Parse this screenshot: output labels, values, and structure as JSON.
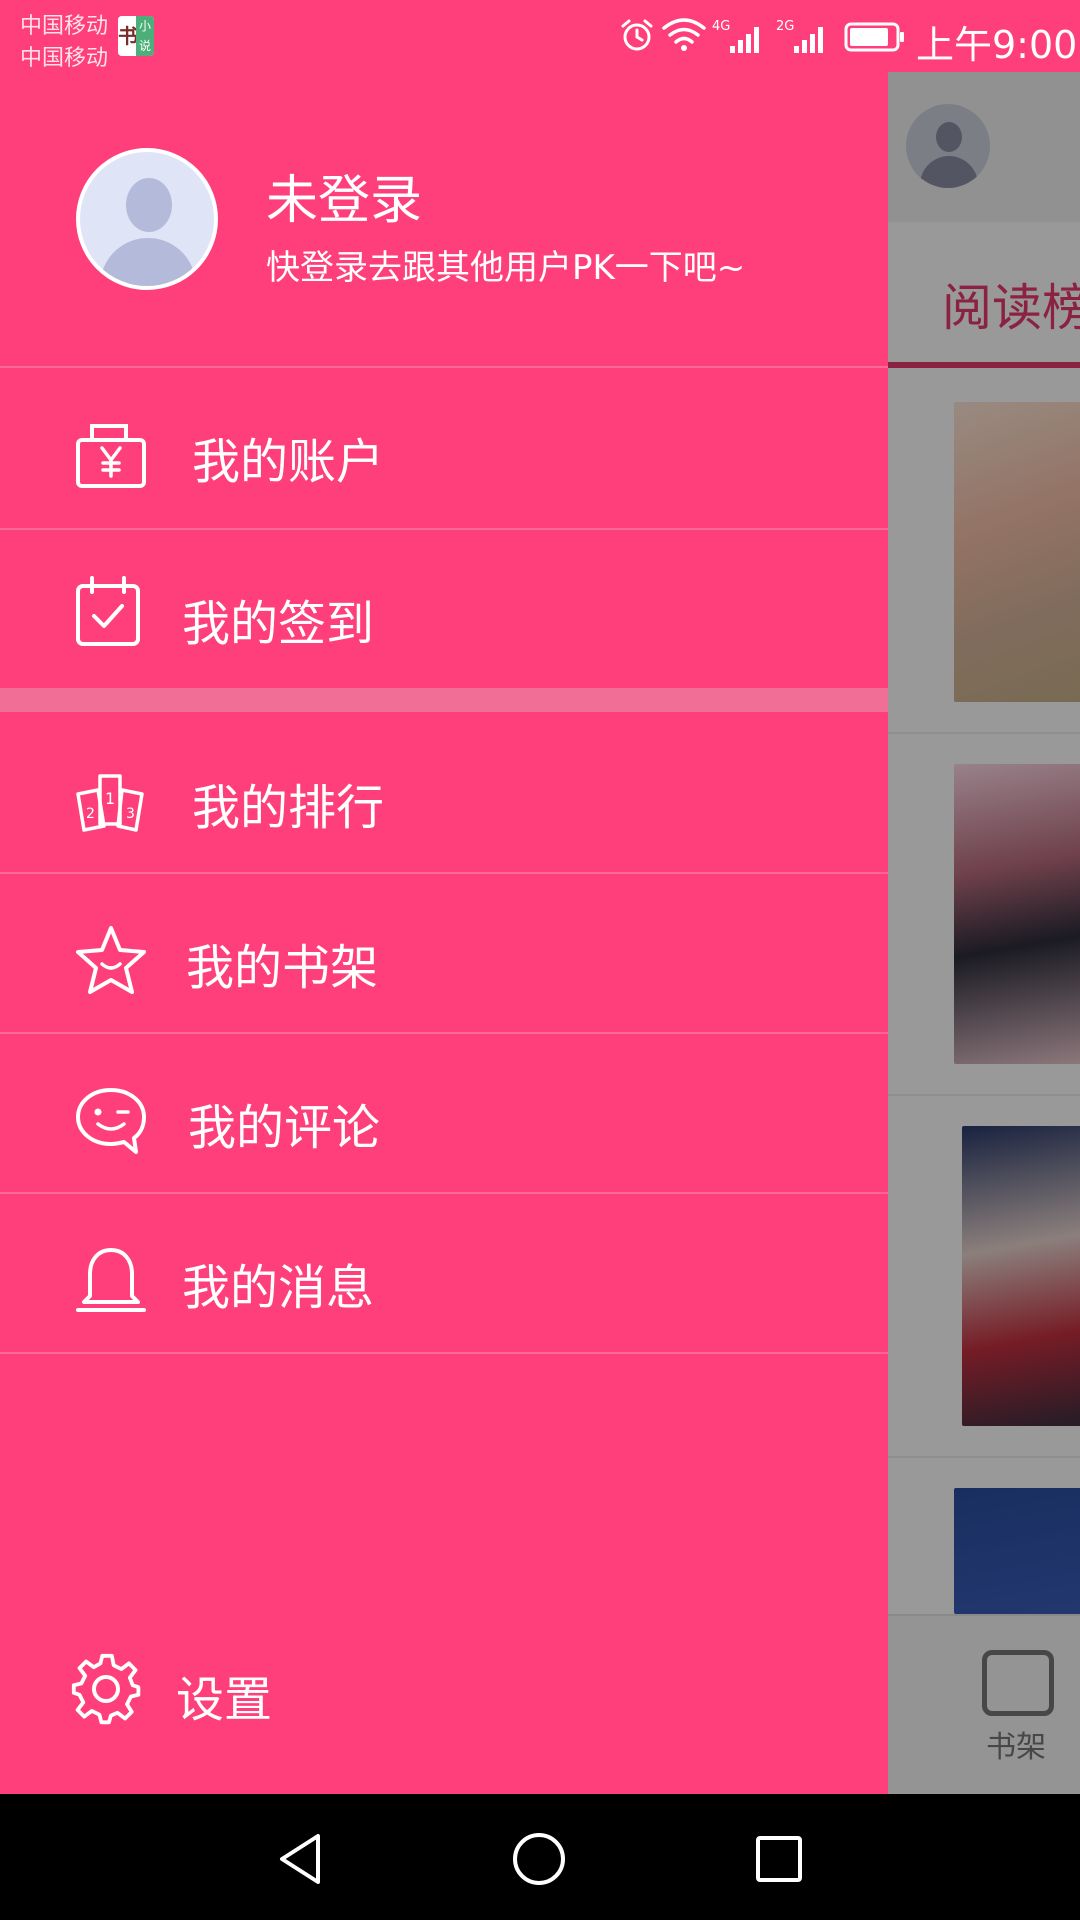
{
  "status_bar": {
    "carrier_1": "中国移动",
    "carrier_2": "中国移动",
    "app_badge_left": "书",
    "app_badge_right": "小说",
    "network_1": "4G",
    "network_2": "2G",
    "time": "上午9:00"
  },
  "profile": {
    "name": "未登录",
    "hint": "快登录去跟其他用户PK一下吧~"
  },
  "menu": {
    "account": "我的账户",
    "checkin": "我的签到",
    "ranking": "我的排行",
    "bookshelf": "我的书架",
    "comments": "我的评论",
    "messages": "我的消息",
    "settings": "设置"
  },
  "background": {
    "tab_label": "阅读榜",
    "bottom_tab_label": "书架"
  },
  "icons": {
    "account": "wallet-yen-icon",
    "checkin": "calendar-check-icon",
    "ranking": "ranking-podium-icon",
    "bookshelf": "star-icon",
    "comments": "chat-wink-icon",
    "messages": "bell-icon",
    "settings": "gear-icon"
  },
  "colors": {
    "drawer_bg": "#ff3f7b",
    "accent": "#e8396f",
    "nav_bar": "#000000"
  }
}
